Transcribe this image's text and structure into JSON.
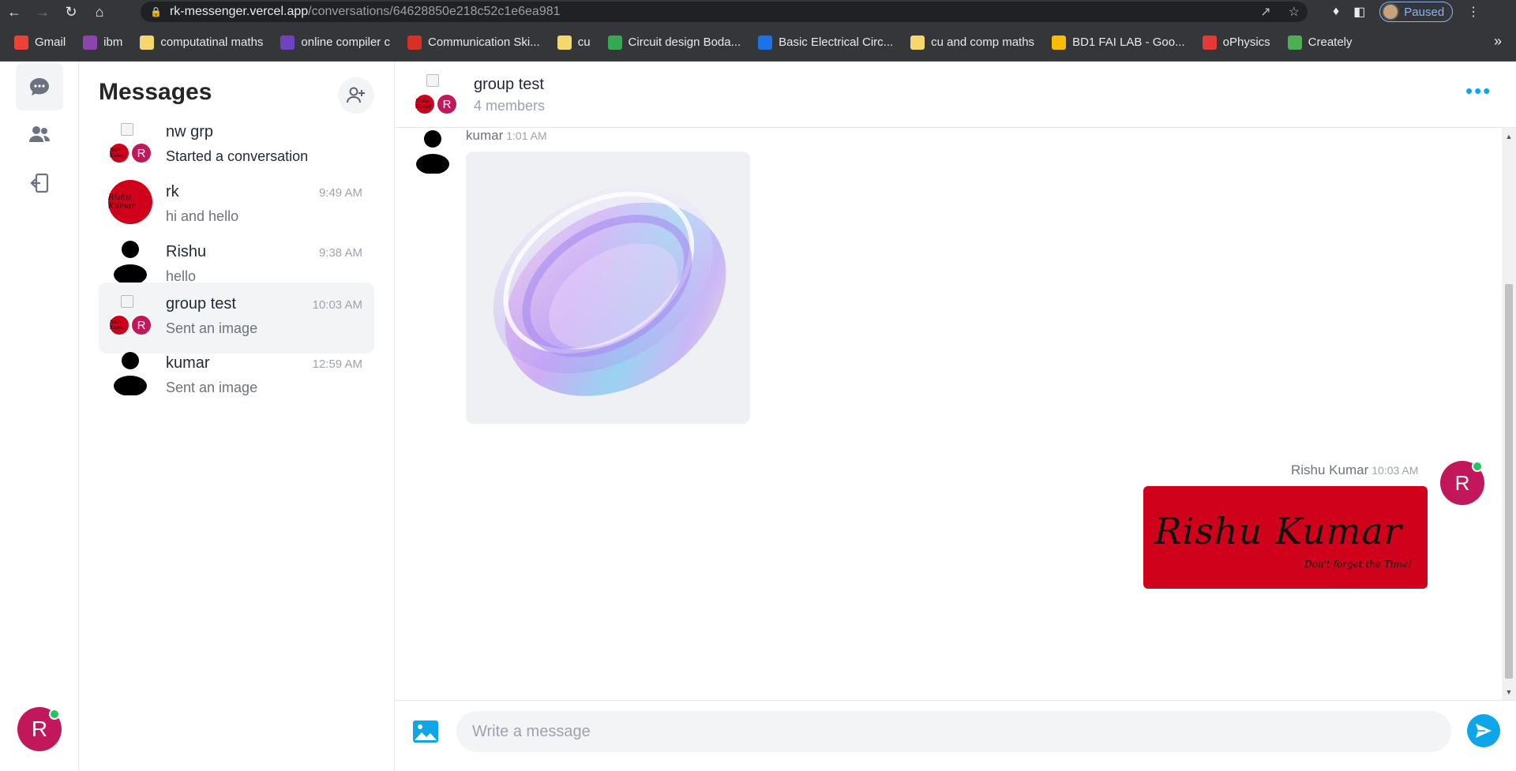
{
  "browser": {
    "url_host": "rk-messenger.vercel.app",
    "url_path": "/conversations/64628850e218c52c1e6ea981",
    "profile_label": "Paused",
    "bookmarks": [
      {
        "label": "Gmail",
        "color": "#ea4335"
      },
      {
        "label": "ibm",
        "color": "#8e44ad"
      },
      {
        "label": "computatinal maths",
        "color": "#f5d76e"
      },
      {
        "label": "online compiler c",
        "color": "#6f42c1"
      },
      {
        "label": "Communication Ski...",
        "color": "#d93025"
      },
      {
        "label": "cu",
        "color": "#f5d76e"
      },
      {
        "label": "Circuit design Boda...",
        "color": "#34a853"
      },
      {
        "label": "Basic Electrical Circ...",
        "color": "#1a73e8"
      },
      {
        "label": "cu and comp maths",
        "color": "#f5d76e"
      },
      {
        "label": "BD1 FAI LAB - Goo...",
        "color": "#fbbc04"
      },
      {
        "label": "oPhysics",
        "color": "#e53935"
      },
      {
        "label": "Creately",
        "color": "#4caf50"
      }
    ]
  },
  "sidebar": {
    "title": "Messages",
    "avatar_initial": "R",
    "conversations": [
      {
        "name": "nw grp",
        "snippet": "Started a conversation",
        "time": "",
        "type": "group",
        "group_initials": [
          "Rishu Kumar",
          "R"
        ]
      },
      {
        "name": "rk",
        "snippet": "hi and hello",
        "time": "9:49 AM",
        "type": "logo",
        "logo_text": "Rishu Kumar"
      },
      {
        "name": "Rishu",
        "snippet": "hello",
        "time": "9:38 AM",
        "type": "person"
      },
      {
        "name": "group test",
        "snippet": "Sent an image",
        "time": "10:03 AM",
        "type": "group",
        "group_initials": [
          "Rishu Kumar",
          "R"
        ]
      },
      {
        "name": "kumar",
        "snippet": "Sent an image",
        "time": "12:59 AM",
        "type": "person"
      }
    ]
  },
  "chat": {
    "title": "group test",
    "members": "4 members",
    "header_initials": [
      "Rishu Kumar",
      "R"
    ],
    "messages": [
      {
        "sender": "kumar",
        "time": "1:01 AM",
        "kind": "image"
      },
      {
        "sender": "Rishu Kumar",
        "time": "10:03 AM",
        "kind": "image",
        "avatar_initial": "R",
        "image_text": "Rishu Kumar",
        "image_tagline": "Don't forget the Time!"
      }
    ],
    "input_placeholder": "Write a message"
  },
  "colors": {
    "accent": "#0ea5e9",
    "avatar": "#c2185b",
    "brand_red": "#d0021b",
    "online": "#22c55e"
  }
}
